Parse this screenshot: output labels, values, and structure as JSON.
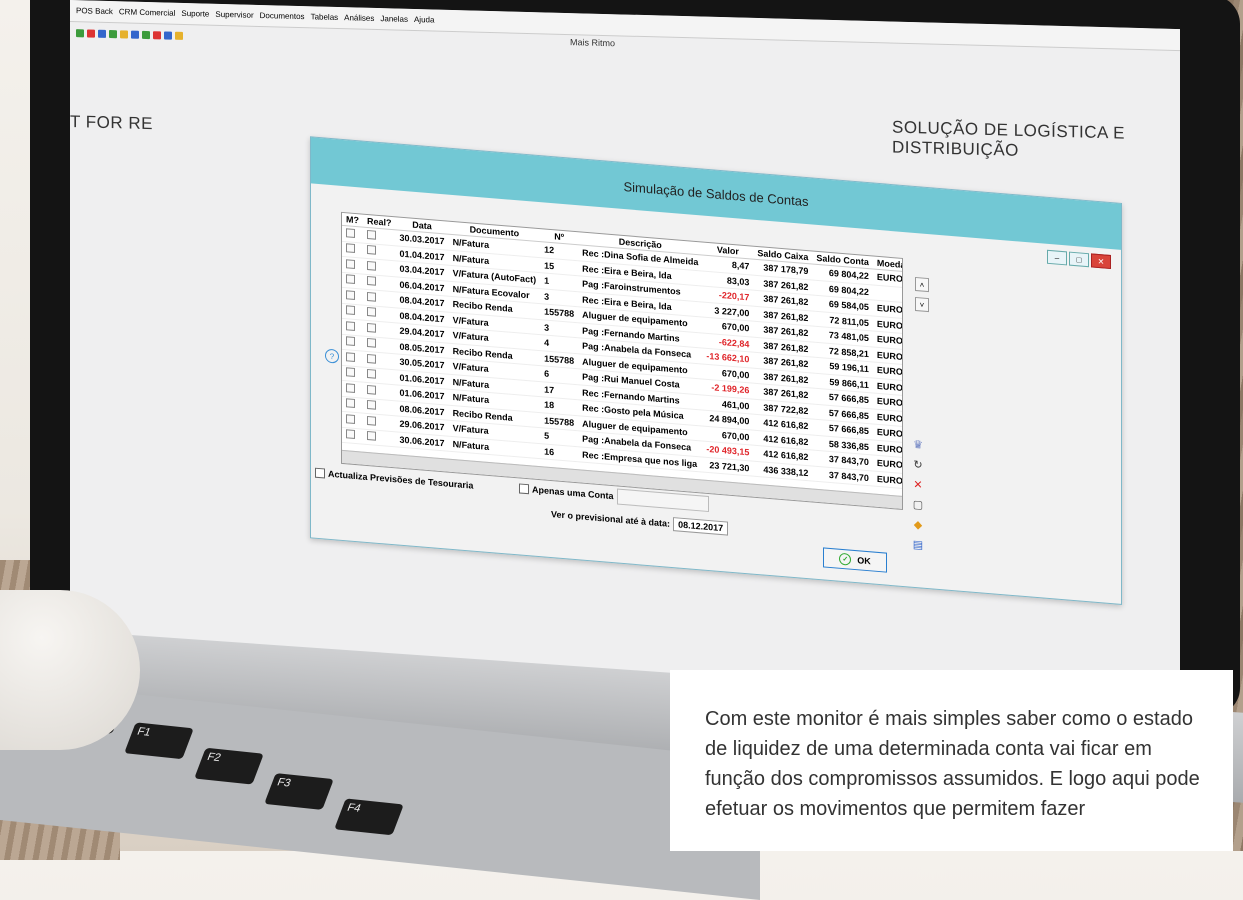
{
  "app": {
    "window_title": "Mais Ritmo",
    "menu": [
      "POS Back",
      "CRM Comercial",
      "Suporte",
      "Supervisor",
      "Documentos",
      "Tabelas",
      "Análises",
      "Janelas",
      "Ajuda"
    ]
  },
  "brand": {
    "left_text": "T FOR   RE",
    "right_text": "SOLUÇÃO DE LOGÍSTICA E DISTRIBUIÇÃO"
  },
  "dialog": {
    "title": "Simulação de Saldos de Contas",
    "columns": [
      "M?",
      "Real?",
      "Data",
      "Documento",
      "Nº",
      "Descrição",
      "Valor",
      "Saldo Caixa",
      "Saldo Conta",
      "Moeda"
    ],
    "rows": [
      {
        "data": "30.03.2017",
        "documento": "N/Fatura",
        "num": "12",
        "descricao": "Rec :Dina Sofia de Almeida",
        "valor": "8,47",
        "saldo_caixa": "387 178,79",
        "saldo_conta": "69 804,22",
        "moeda": "EURO",
        "neg": false
      },
      {
        "data": "01.04.2017",
        "documento": "N/Fatura",
        "num": "15",
        "descricao": "Rec :Eira e Beira, lda",
        "valor": "83,03",
        "saldo_caixa": "387 261,82",
        "saldo_conta": "69 804,22",
        "moeda": "",
        "neg": false
      },
      {
        "data": "03.04.2017",
        "documento": "V/Fatura (AutoFact)",
        "num": "1",
        "descricao": "Pag :Faroinstrumentos",
        "valor": "-220,17",
        "saldo_caixa": "387 261,82",
        "saldo_conta": "69 584,05",
        "moeda": "EURO",
        "neg": true
      },
      {
        "data": "06.04.2017",
        "documento": "N/Fatura Ecovalor",
        "num": "3",
        "descricao": "Rec :Eira e Beira, lda",
        "valor": "3 227,00",
        "saldo_caixa": "387 261,82",
        "saldo_conta": "72 811,05",
        "moeda": "EURO",
        "neg": false
      },
      {
        "data": "08.04.2017",
        "documento": "Recibo Renda",
        "num": "155788",
        "descricao": "Aluguer de equipamento",
        "valor": "670,00",
        "saldo_caixa": "387 261,82",
        "saldo_conta": "73 481,05",
        "moeda": "EURO",
        "neg": false
      },
      {
        "data": "08.04.2017",
        "documento": "V/Fatura",
        "num": "3",
        "descricao": "Pag :Fernando Martins",
        "valor": "-622,84",
        "saldo_caixa": "387 261,82",
        "saldo_conta": "72 858,21",
        "moeda": "EURO",
        "neg": true
      },
      {
        "data": "29.04.2017",
        "documento": "V/Fatura",
        "num": "4",
        "descricao": "Pag :Anabela da Fonseca",
        "valor": "-13 662,10",
        "saldo_caixa": "387 261,82",
        "saldo_conta": "59 196,11",
        "moeda": "EURO",
        "neg": true
      },
      {
        "data": "08.05.2017",
        "documento": "Recibo Renda",
        "num": "155788",
        "descricao": "Aluguer de equipamento",
        "valor": "670,00",
        "saldo_caixa": "387 261,82",
        "saldo_conta": "59 866,11",
        "moeda": "EURO",
        "neg": false
      },
      {
        "data": "30.05.2017",
        "documento": "V/Fatura",
        "num": "6",
        "descricao": "Pag :Rui Manuel Costa",
        "valor": "-2 199,26",
        "saldo_caixa": "387 261,82",
        "saldo_conta": "57 666,85",
        "moeda": "EURO",
        "neg": true
      },
      {
        "data": "01.06.2017",
        "documento": "N/Fatura",
        "num": "17",
        "descricao": "Rec :Fernando Martins",
        "valor": "461,00",
        "saldo_caixa": "387 722,82",
        "saldo_conta": "57 666,85",
        "moeda": "EURO",
        "neg": false
      },
      {
        "data": "01.06.2017",
        "documento": "N/Fatura",
        "num": "18",
        "descricao": "Rec :Gosto pela Música",
        "valor": "24 894,00",
        "saldo_caixa": "412 616,82",
        "saldo_conta": "57 666,85",
        "moeda": "EURO",
        "neg": false
      },
      {
        "data": "08.06.2017",
        "documento": "Recibo Renda",
        "num": "155788",
        "descricao": "Aluguer de equipamento",
        "valor": "670,00",
        "saldo_caixa": "412 616,82",
        "saldo_conta": "58 336,85",
        "moeda": "EURO",
        "neg": false
      },
      {
        "data": "29.06.2017",
        "documento": "V/Fatura",
        "num": "5",
        "descricao": "Pag :Anabela da Fonseca",
        "valor": "-20 493,15",
        "saldo_caixa": "412 616,82",
        "saldo_conta": "37 843,70",
        "moeda": "EURO",
        "neg": true
      },
      {
        "data": "30.06.2017",
        "documento": "N/Fatura",
        "num": "16",
        "descricao": "Rec :Empresa que nos liga",
        "valor": "23 721,30",
        "saldo_caixa": "436 338,12",
        "saldo_conta": "37 843,70",
        "moeda": "EURO",
        "neg": false
      }
    ],
    "opt_tesouraria": "Actualiza Previsões de Tesouraria",
    "opt_conta": "Apenas uma Conta",
    "date_label": "Ver o previsional até à data:",
    "date_value": "08.12.2017",
    "ok_label": "OK"
  },
  "caption": "Com este monitor é mais simples saber como o estado de liquidez de uma determinada conta vai ficar em função dos compromissos assumidos. E logo aqui pode efetuar os movimentos que permitem fazer"
}
